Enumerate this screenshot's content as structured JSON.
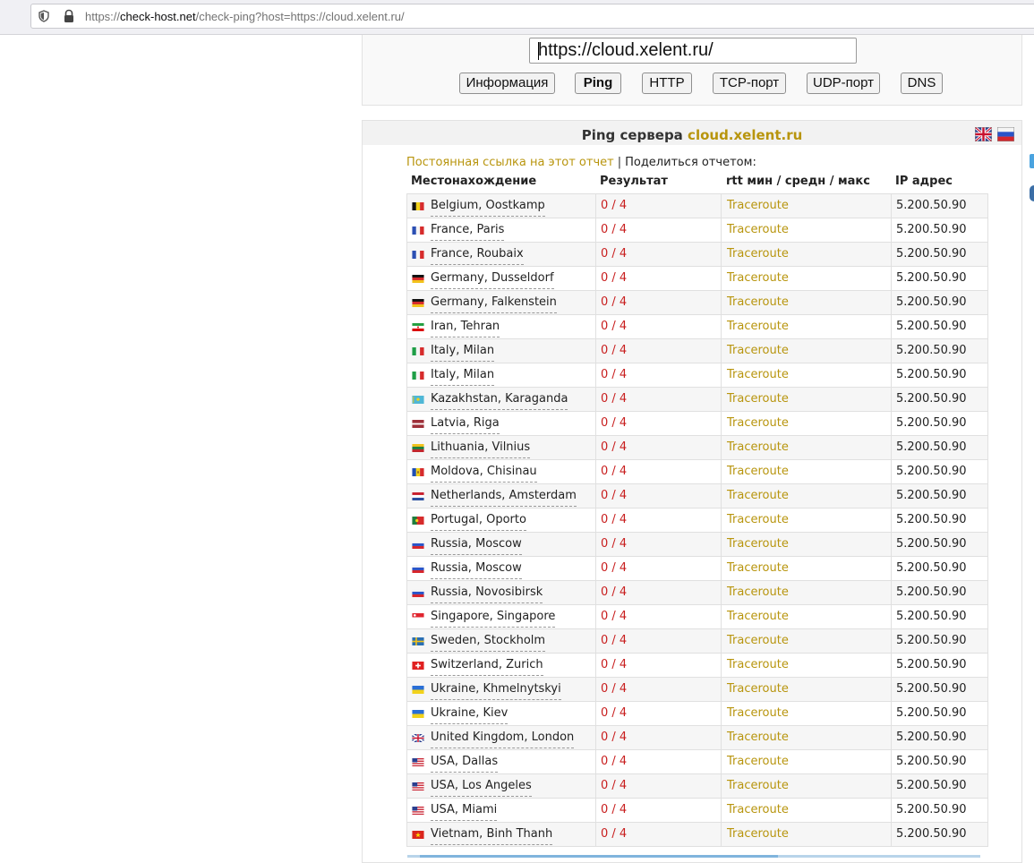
{
  "browser": {
    "url_prefix": "https://",
    "url_domain": "check-host.net",
    "url_path": "/check-ping?host=https://cloud.xelent.ru/"
  },
  "host_input": {
    "value": "https://cloud.xelent.ru/"
  },
  "nav_buttons": [
    {
      "label": "Информация"
    },
    {
      "label": "Ping"
    },
    {
      "label": "HTTP"
    },
    {
      "label": "TCP-порт"
    },
    {
      "label": "UDP-порт"
    },
    {
      "label": "DNS"
    }
  ],
  "result": {
    "title_prefix": "Ping сервера",
    "title_host": "cloud.xelent.ru",
    "permalink": "Постоянная ссылка на этот отчет",
    "separator": "|",
    "share": "Поделиться отчетом:",
    "columns": {
      "location": "Местонахождение",
      "result": "Результат",
      "rtt": "rtt мин / средн / макс",
      "ip": "IP адрес"
    },
    "rows": [
      {
        "flag": "be",
        "location": "Belgium, Oostkamp",
        "result": "0 / 4",
        "rtt": "Traceroute",
        "ip": "5.200.50.90"
      },
      {
        "flag": "fr",
        "location": "France, Paris",
        "result": "0 / 4",
        "rtt": "Traceroute",
        "ip": "5.200.50.90"
      },
      {
        "flag": "fr",
        "location": "France, Roubaix",
        "result": "0 / 4",
        "rtt": "Traceroute",
        "ip": "5.200.50.90"
      },
      {
        "flag": "de",
        "location": "Germany, Dusseldorf",
        "result": "0 / 4",
        "rtt": "Traceroute",
        "ip": "5.200.50.90"
      },
      {
        "flag": "de",
        "location": "Germany, Falkenstein",
        "result": "0 / 4",
        "rtt": "Traceroute",
        "ip": "5.200.50.90"
      },
      {
        "flag": "ir",
        "location": "Iran, Tehran",
        "result": "0 / 4",
        "rtt": "Traceroute",
        "ip": "5.200.50.90"
      },
      {
        "flag": "it",
        "location": "Italy, Milan",
        "result": "0 / 4",
        "rtt": "Traceroute",
        "ip": "5.200.50.90"
      },
      {
        "flag": "it",
        "location": "Italy, Milan",
        "result": "0 / 4",
        "rtt": "Traceroute",
        "ip": "5.200.50.90"
      },
      {
        "flag": "kz",
        "location": "Kazakhstan, Karaganda",
        "result": "0 / 4",
        "rtt": "Traceroute",
        "ip": "5.200.50.90"
      },
      {
        "flag": "lv",
        "location": "Latvia, Riga",
        "result": "0 / 4",
        "rtt": "Traceroute",
        "ip": "5.200.50.90"
      },
      {
        "flag": "lt",
        "location": "Lithuania, Vilnius",
        "result": "0 / 4",
        "rtt": "Traceroute",
        "ip": "5.200.50.90"
      },
      {
        "flag": "md",
        "location": "Moldova, Chisinau",
        "result": "0 / 4",
        "rtt": "Traceroute",
        "ip": "5.200.50.90"
      },
      {
        "flag": "nl",
        "location": "Netherlands, Amsterdam",
        "result": "0 / 4",
        "rtt": "Traceroute",
        "ip": "5.200.50.90"
      },
      {
        "flag": "pt",
        "location": "Portugal, Oporto",
        "result": "0 / 4",
        "rtt": "Traceroute",
        "ip": "5.200.50.90"
      },
      {
        "flag": "ru",
        "location": "Russia, Moscow",
        "result": "0 / 4",
        "rtt": "Traceroute",
        "ip": "5.200.50.90"
      },
      {
        "flag": "ru",
        "location": "Russia, Moscow",
        "result": "0 / 4",
        "rtt": "Traceroute",
        "ip": "5.200.50.90"
      },
      {
        "flag": "ru",
        "location": "Russia, Novosibirsk",
        "result": "0 / 4",
        "rtt": "Traceroute",
        "ip": "5.200.50.90"
      },
      {
        "flag": "sg",
        "location": "Singapore, Singapore",
        "result": "0 / 4",
        "rtt": "Traceroute",
        "ip": "5.200.50.90"
      },
      {
        "flag": "se",
        "location": "Sweden, Stockholm",
        "result": "0 / 4",
        "rtt": "Traceroute",
        "ip": "5.200.50.90"
      },
      {
        "flag": "ch",
        "location": "Switzerland, Zurich",
        "result": "0 / 4",
        "rtt": "Traceroute",
        "ip": "5.200.50.90"
      },
      {
        "flag": "ua",
        "location": "Ukraine, Khmelnytskyi",
        "result": "0 / 4",
        "rtt": "Traceroute",
        "ip": "5.200.50.90"
      },
      {
        "flag": "ua",
        "location": "Ukraine, Kiev",
        "result": "0 / 4",
        "rtt": "Traceroute",
        "ip": "5.200.50.90"
      },
      {
        "flag": "gb",
        "location": "United Kingdom, London",
        "result": "0 / 4",
        "rtt": "Traceroute",
        "ip": "5.200.50.90"
      },
      {
        "flag": "us",
        "location": "USA, Dallas",
        "result": "0 / 4",
        "rtt": "Traceroute",
        "ip": "5.200.50.90"
      },
      {
        "flag": "us",
        "location": "USA, Los Angeles",
        "result": "0 / 4",
        "rtt": "Traceroute",
        "ip": "5.200.50.90"
      },
      {
        "flag": "us",
        "location": "USA, Miami",
        "result": "0 / 4",
        "rtt": "Traceroute",
        "ip": "5.200.50.90"
      },
      {
        "flag": "vn",
        "location": "Vietnam, Binh Thanh",
        "result": "0 / 4",
        "rtt": "Traceroute",
        "ip": "5.200.50.90"
      }
    ]
  },
  "colors": {
    "accent": "#b8950e",
    "fail": "#c81e1e"
  }
}
